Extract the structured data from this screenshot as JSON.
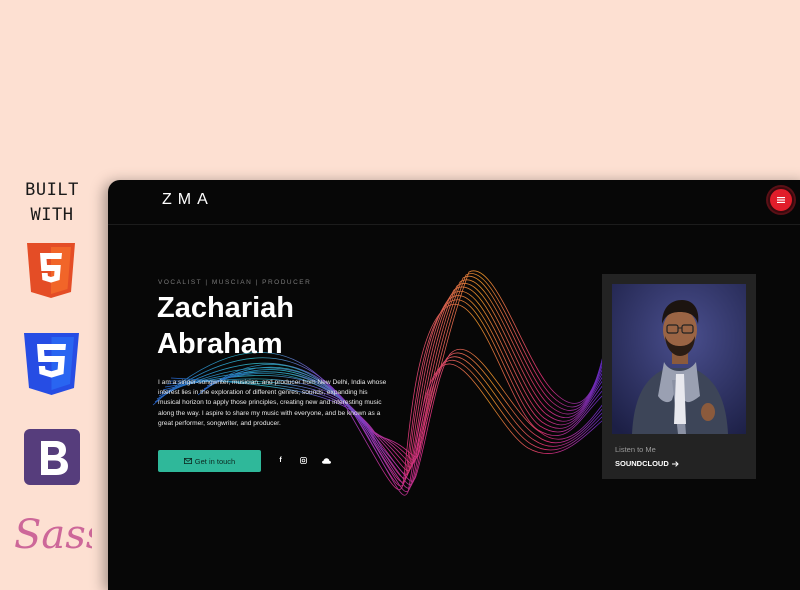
{
  "sidebar": {
    "built_line1": "BUILT",
    "built_line2": "WITH",
    "tech_icons": [
      "html5-icon",
      "css3-icon",
      "bootstrap-icon",
      "sass-icon"
    ]
  },
  "site": {
    "logo": "ZMA",
    "menu_icon": "hamburger-icon",
    "accent": "#e11d2a",
    "hero": {
      "eyebrow": "VOCALIST | MUSCIAN | PRODUCER",
      "name_line1": "Zachariah",
      "name_line2": "Abraham",
      "bio_lines": [
        "I am a singer-songwriter, musician, and producer from New Delhi, India whose",
        "interest lies in the exploration of different genres, sounds, expanding his",
        "musical horizon to apply those principles, creating new and interesting music",
        "along the way. I aspire to share my music with everyone, and be known as a",
        "great performer, songwriter, and producer."
      ],
      "cta_label": "Get in touch",
      "cta_color": "#2fb89a",
      "social_icons": [
        "facebook-icon",
        "instagram-icon",
        "soundcloud-icon"
      ]
    },
    "card": {
      "listen_label": "Listen to Me",
      "soundcloud_label": "SOUNDCLOUD"
    }
  }
}
